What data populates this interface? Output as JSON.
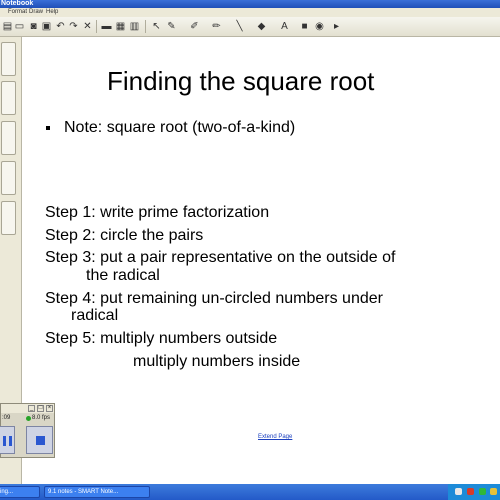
{
  "window": {
    "title": "Notebook"
  },
  "menu": {
    "items": [
      "Format",
      "Draw",
      "Help"
    ]
  },
  "toolbar": {
    "buttons": [
      "new-page-icon",
      "open-icon",
      "save-icon",
      "paste-icon",
      "undo-icon",
      "redo-icon",
      "delete-icon",
      "screen-shade-icon",
      "full-screen-icon",
      "table-icon",
      "select-icon",
      "pen-icon",
      "creative-pen-icon",
      "highlighter-icon",
      "line-icon",
      "shape-icon",
      "text-icon",
      "fill-icon",
      "properties-icon",
      "move-toolbar-icon"
    ]
  },
  "slide": {
    "title": "Finding the square root",
    "note": "Note: square root (two-of-a-kind)",
    "steps": [
      "Step 1: write prime factorization",
      "Step 2: circle the pairs",
      "Step 3: put a pair representative on the outside of",
      "the radical",
      "Step 4: put remaining un-circled numbers under",
      "radical",
      "Step 5: multiply numbers outside",
      "multiply numbers inside"
    ],
    "extend_page": "Extend Page"
  },
  "recorder": {
    "time": ":09",
    "fps": "8.0 fps"
  },
  "taskbar": {
    "items": [
      "ing...",
      "9.1 notes - SMART Note..."
    ]
  },
  "colors": {
    "title_bar": "#1f4fb8",
    "recorder_button": "#2a57d0",
    "taskbar": "#245ac8",
    "link": "#1a3fbf"
  }
}
